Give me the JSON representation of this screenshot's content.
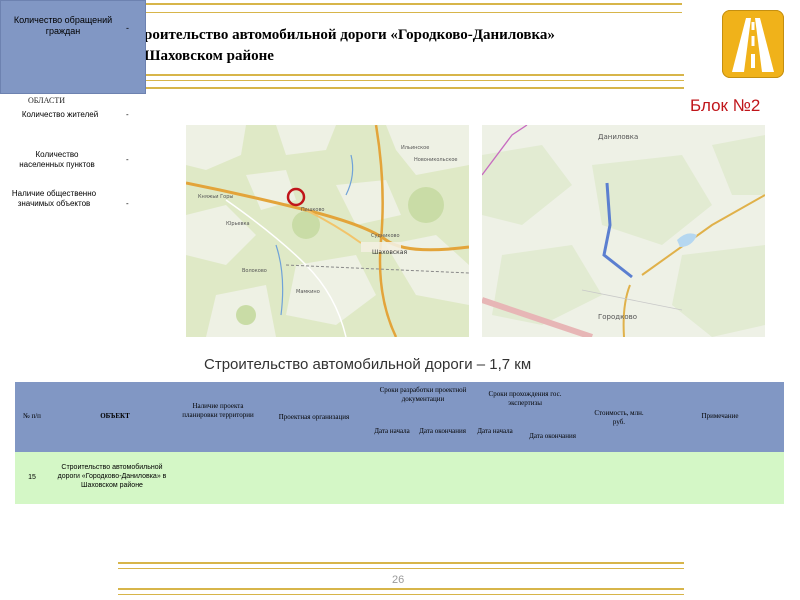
{
  "header": {
    "title_line1": "роительство автомобильной дороги «Городково-Даниловка»",
    "title_line2": "Шаховском районе",
    "block_label": "Блок №2"
  },
  "info": {
    "appeals_label": "Количество обращений граждан",
    "appeals_value": "-",
    "region_label": "ОБЛАСТИ",
    "rows": [
      {
        "label": "Количество жителей",
        "value": "-"
      },
      {
        "label": "Количество населенных пунктов",
        "value": "-"
      },
      {
        "label": "Наличие общественно значимых объектов",
        "value": "-"
      }
    ]
  },
  "map_left": {
    "places": [
      "Шаховская",
      "Ильинское",
      "Мамкино",
      "Новоникольское",
      "Судниково",
      "Волоково",
      "Княжьи Горы",
      "Юрьевка",
      "Пашково"
    ]
  },
  "map_right": {
    "places": [
      "Даниловка",
      "Городково"
    ]
  },
  "caption": "Строительство автомобильной дороги – 1,7 км",
  "table": {
    "headers": {
      "num": "№ п/п",
      "object": "ОБЪЕКТ",
      "planning": "Наличие проекта планировки территории",
      "org": "Проектная организация",
      "design_group": "Сроки разработки проектной документации",
      "review_group": "Сроки прохождения гос. экспертизы",
      "start1": "Дата начала",
      "end1": "Дата окончания",
      "start2": "Дата начала",
      "end2": "Дата окончания",
      "cost": "Стоимость, млн. руб.",
      "note": "Примечание"
    },
    "row": {
      "num": "15",
      "object": "Строительство автомобильной дороги «Городково-Даниловка» в Шаховском районе"
    }
  },
  "page_number": "26",
  "colors": {
    "gold": "#d7b54a",
    "header_blue": "#8197c4",
    "row_green": "#d4f7c6",
    "block_red": "#c0151a",
    "route_blue": "#5b7fd0"
  }
}
